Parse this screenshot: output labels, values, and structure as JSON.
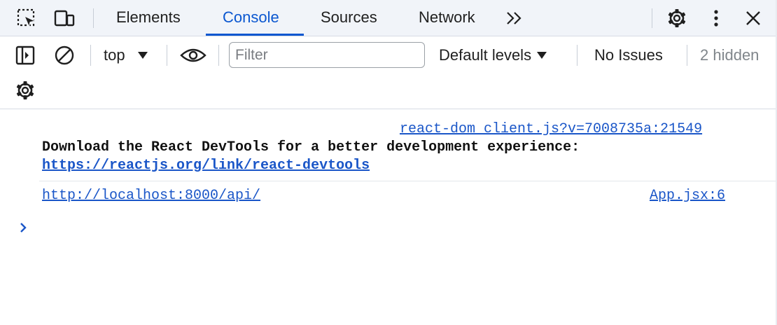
{
  "tabs": [
    {
      "label": "Elements"
    },
    {
      "label": "Console"
    },
    {
      "label": "Sources"
    },
    {
      "label": "Network"
    }
  ],
  "active_tab": "Console",
  "more_tabs_icon": "double-chevron-right-icon",
  "toolbar": {
    "context": "top",
    "filter_placeholder": "Filter",
    "filter_value": "",
    "levels": "Default levels",
    "issues": "No Issues",
    "hidden": "2 hidden"
  },
  "messages": [
    {
      "source": "react-dom_client.js?v=7008735a:21549",
      "text": "Download the React DevTools for a better development experience:",
      "url": "https://reactjs.org/link/react-devtools"
    },
    {
      "source": "App.jsx:6",
      "url": "http://localhost:8000/api/"
    }
  ],
  "colors": {
    "accent": "#0b57d0",
    "link": "#1a56c8",
    "tabbar_bg": "#f1f4f9"
  }
}
